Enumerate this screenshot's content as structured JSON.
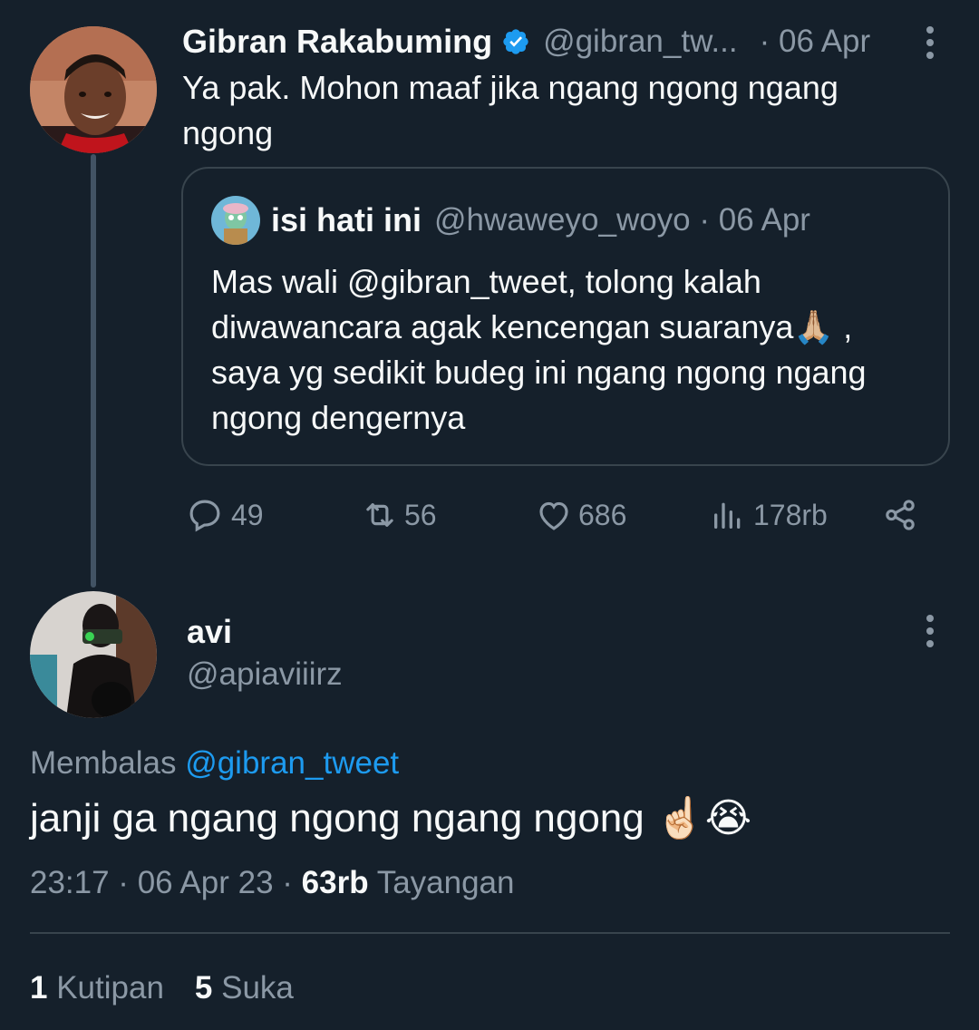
{
  "original_tweet": {
    "author_name": "Gibran Rakabuming",
    "handle": "@gibran_tw...",
    "date": "· 06 Apr",
    "text_line1": "Ya pak. Mohon maaf jika ngang ngong ngang",
    "text_line2": "ngong",
    "verified": true,
    "quoted": {
      "author_name": "isi hati ini",
      "handle": "@hwaweyo_woyo · 06 Apr",
      "line1": "Mas wali @gibran_tweet, tolong kalah",
      "line2": "diwawancara agak kencengan suaranya🙏🏼 ,",
      "line3": "saya yg sedikit budeg ini ngang ngong ngang",
      "line4": "ngong dengernya"
    },
    "actions": {
      "replies": "49",
      "retweets": "56",
      "likes": "686",
      "views": "178rb"
    }
  },
  "reply_tweet": {
    "author_name": "avi",
    "handle": "@apiaviiirz",
    "replying_prefix": "Membalas",
    "replying_to": "@gibran_tweet",
    "text": "janji ga ngang ngong ngang ngong ☝🏻😭",
    "time": "23:17 · 06 Apr 23 ·",
    "views_count": "63rb",
    "views_label": "Tayangan",
    "quotes_count": "1",
    "quotes_label": "Kutipan",
    "likes_count": "5",
    "likes_label": "Suka"
  },
  "colors": {
    "background": "#15202b",
    "text": "#f7f9f9",
    "muted": "#8b98a5",
    "link": "#1d9bf0",
    "border": "#38444d"
  },
  "icons": [
    "verified-badge-icon",
    "more-icon",
    "reply-icon",
    "retweet-icon",
    "like-icon",
    "views-icon",
    "share-icon"
  ]
}
